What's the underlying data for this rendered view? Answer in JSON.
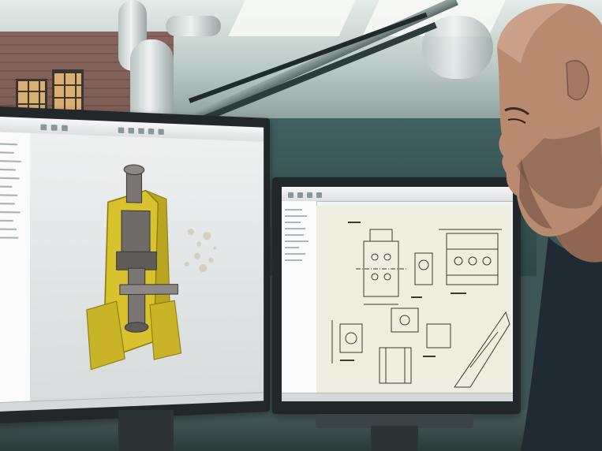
{
  "scene": {
    "description_type": "photograph",
    "colors": {
      "ceiling": "#d8e1df",
      "wall_teal": "#3b5a59",
      "monitor_bezel": "#22272a",
      "cad_part_yellow": "#d8c22e",
      "cad_part_gray": "#6e6a68",
      "drawing_paper": "#eeeee0",
      "drawing_lines": "#3a3a32",
      "skin": "#b88a6f",
      "shirt": "#1f2a33"
    },
    "icons": [
      "cad-3d-model-icon",
      "engineering-drawing-icon"
    ]
  }
}
